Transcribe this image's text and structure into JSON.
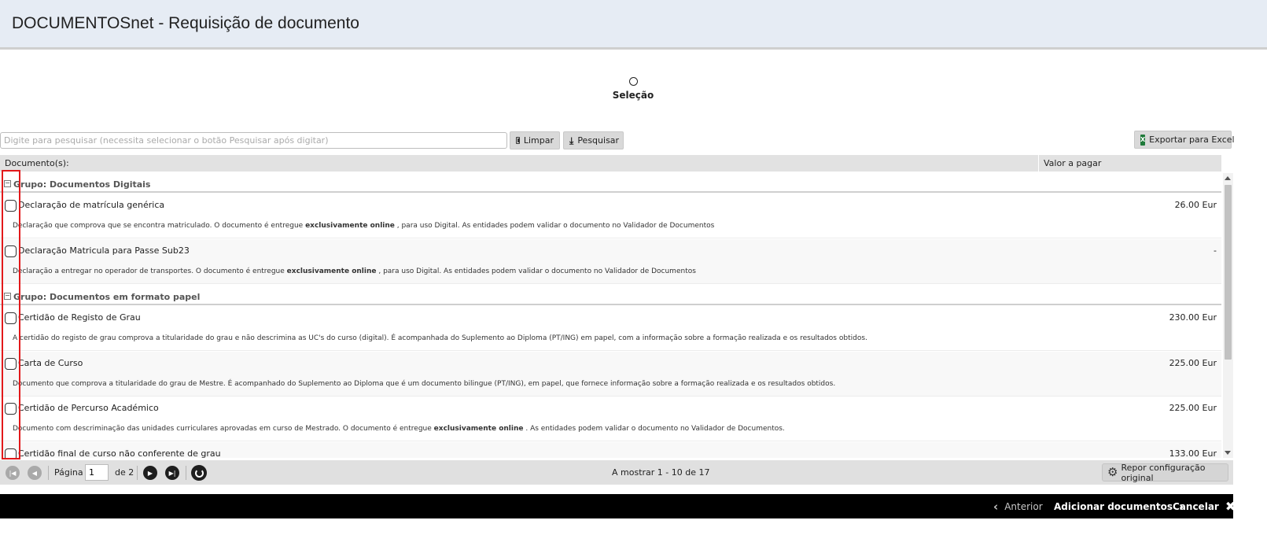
{
  "header": {
    "title": "DOCUMENTOSnet - Requisição de documento"
  },
  "step": {
    "label": "Seleção"
  },
  "search": {
    "placeholder": "Digite para pesquisar (necessita selecionar o botão Pesquisar após digitar)",
    "value": "",
    "clear_label": "Limpar",
    "search_label": "Pesquisar",
    "export_label": "Exportar para Excel",
    "excel_glyph": "X"
  },
  "grid": {
    "col_document": "Documento(s):",
    "col_value": "Valor a pagar",
    "groups": [
      {
        "label": "Grupo: Documentos Digitais",
        "rows": [
          {
            "name": "Declaração de matrícula genérica",
            "value": "26.00 Eur",
            "desc_pre": "Declaração que comprova que se encontra matriculado. O documento é entregue ",
            "desc_bold": "exclusivamente online",
            "desc_post": " , para uso Digital. As entidades podem validar o documento no Validador de Documentos"
          },
          {
            "name": "Declaração Matricula para Passe Sub23",
            "value": "-",
            "desc_pre": "Declaração a entregar no operador de transportes. O documento é entregue ",
            "desc_bold": "exclusivamente online",
            "desc_post": " , para uso Digital. As entidades podem validar o documento no Validador de Documentos"
          }
        ]
      },
      {
        "label": "Grupo: Documentos em formato papel",
        "rows": [
          {
            "name": "Certidão de Registo de Grau",
            "value": "230.00 Eur",
            "desc_pre": "A certidão do registo de grau comprova a titularidade do grau e não descrimina as UC's do curso (digital). É acompanhada do Suplemento ao Diploma (PT/ING) em papel, com a informação sobre a formação realizada e os resultados obtidos.",
            "desc_bold": "",
            "desc_post": ""
          },
          {
            "name": "Carta de Curso",
            "value": "225.00 Eur",
            "desc_pre": "Documento que comprova a titularidade do grau de Mestre. É acompanhado do Suplemento ao Diploma que é um documento bilingue (PT/ING), em papel, que fornece informação sobre a formação realizada e os resultados obtidos.",
            "desc_bold": "",
            "desc_post": ""
          },
          {
            "name": "Certidão de Percurso Académico",
            "value": "225.00 Eur",
            "desc_pre": "Documento com descriminação das unidades curriculares aprovadas em curso de Mestrado. O documento é entregue ",
            "desc_bold": "exclusivamente online",
            "desc_post": " . As entidades podem validar o documento no Validador de Documentos."
          },
          {
            "name": "Certidão final de curso não conferente de grau",
            "value": "133.00 Eur",
            "desc_pre": "",
            "desc_bold": "",
            "desc_post": ""
          }
        ]
      }
    ]
  },
  "pager": {
    "page_label": "Página",
    "page_value": "1",
    "of_label": "de 2",
    "showing": "A mostrar 1 - 10 de 17",
    "reset_label": "Repor configuração original"
  },
  "footer": {
    "previous_label": "Anterior",
    "add_label": "Adicionar documentos",
    "cancel_label": "Cancelar"
  }
}
